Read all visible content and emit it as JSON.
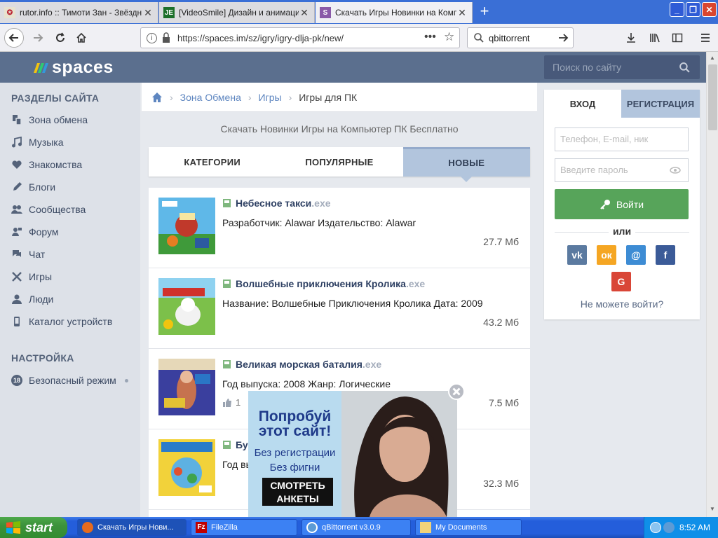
{
  "browser": {
    "tabs": [
      {
        "title": "rutor.info :: Тимоти Зан - Звёздн",
        "active": false
      },
      {
        "title": "[VideoSmile] Дизайн и анимация П",
        "active": false
      },
      {
        "title": "Скачать Игры Новинки на Компь",
        "active": true
      }
    ],
    "url": "https://spaces.im/sz/igry/igry-dlja-pk/new/",
    "search_value": "qbittorrent"
  },
  "site": {
    "logo": "spaces",
    "search_placeholder": "Поиск по сайту"
  },
  "sidebar": {
    "section_title": "РАЗДЕЛЫ САЙТА",
    "items": [
      {
        "label": "Зона обмена",
        "icon": "exchange-icon"
      },
      {
        "label": "Музыка",
        "icon": "music-icon"
      },
      {
        "label": "Знакомства",
        "icon": "heart-icon"
      },
      {
        "label": "Блоги",
        "icon": "pen-icon"
      },
      {
        "label": "Сообщества",
        "icon": "community-icon"
      },
      {
        "label": "Форум",
        "icon": "forum-icon"
      },
      {
        "label": "Чат",
        "icon": "chat-icon"
      },
      {
        "label": "Игры",
        "icon": "games-icon"
      },
      {
        "label": "Люди",
        "icon": "people-icon"
      },
      {
        "label": "Каталог устройств",
        "icon": "phone-icon"
      }
    ],
    "settings_title": "НАСТРОЙКА",
    "safe_mode_badge": "18",
    "safe_mode_label": "Безопасный режим"
  },
  "breadcrumb": {
    "items": [
      "Зона Обмена",
      "Игры"
    ],
    "current": "Игры для ПК"
  },
  "main": {
    "subtitle": "Скачать Новинки Игры на Компьютер ПК Бесплатно",
    "tabs": [
      {
        "label": "КАТЕГОРИИ",
        "active": false
      },
      {
        "label": "ПОПУЛЯРНЫЕ",
        "active": false
      },
      {
        "label": "НОВЫЕ",
        "active": true
      }
    ],
    "files": [
      {
        "name": "Небесное такси",
        "ext": ".exe",
        "desc": "Разработчик: Alawar Издательство: Alawar",
        "size": "27.7 Мб",
        "likes": ""
      },
      {
        "name": "Волшебные приключения Кролика",
        "ext": ".exe",
        "desc": "Название: Волшебные Приключения Кролика Дата: 2009",
        "size": "43.2 Мб",
        "likes": ""
      },
      {
        "name": "Великая морская баталия",
        "ext": ".exe",
        "desc": "Год выпуска: 2008 Жанр: Логические",
        "size": "7.5 Мб",
        "likes": "1"
      },
      {
        "name": "Бу",
        "ext": "",
        "desc": "Год вы",
        "size": "32.3 Мб",
        "likes": ""
      }
    ]
  },
  "login": {
    "tab_login": "ВХОД",
    "tab_register": "РЕГИСТРАЦИЯ",
    "login_placeholder": "Телефон, E-mail, ник",
    "password_placeholder": "Введите пароль",
    "button": "Войти",
    "or": "или",
    "socials": [
      {
        "icon": "vk-icon",
        "label": "vk",
        "color": "#5b7aa0"
      },
      {
        "icon": "odnoklassniki-icon",
        "label": "ок",
        "color": "#f5a623"
      },
      {
        "icon": "mailru-icon",
        "label": "@",
        "color": "#3d8cd4"
      },
      {
        "icon": "facebook-icon",
        "label": "f",
        "color": "#3b5b98"
      },
      {
        "icon": "google-icon",
        "label": "G",
        "color": "#d94637"
      }
    ],
    "cant_login": "Не можете войти?"
  },
  "ad": {
    "line1": "Попробуй",
    "line2": "этот сайт!",
    "line3": "Без регистрации",
    "line4": "Без фигни",
    "button_line1": "СМОТРЕТЬ",
    "button_line2": "АНКЕТЫ"
  },
  "taskbar": {
    "start": "start",
    "items": [
      {
        "label": "Скачать Игры Нови...",
        "active": true
      },
      {
        "label": "FileZilla",
        "active": false
      },
      {
        "label": "qBittorrent v3.0.9",
        "active": false
      },
      {
        "label": "My Documents",
        "active": false
      }
    ],
    "clock": "8:52 AM"
  },
  "colors": {
    "site_header": "#5b6f8e",
    "accent_tab": "#b2c5dd",
    "login_button": "#57a45a",
    "link": "#5e86c0"
  }
}
